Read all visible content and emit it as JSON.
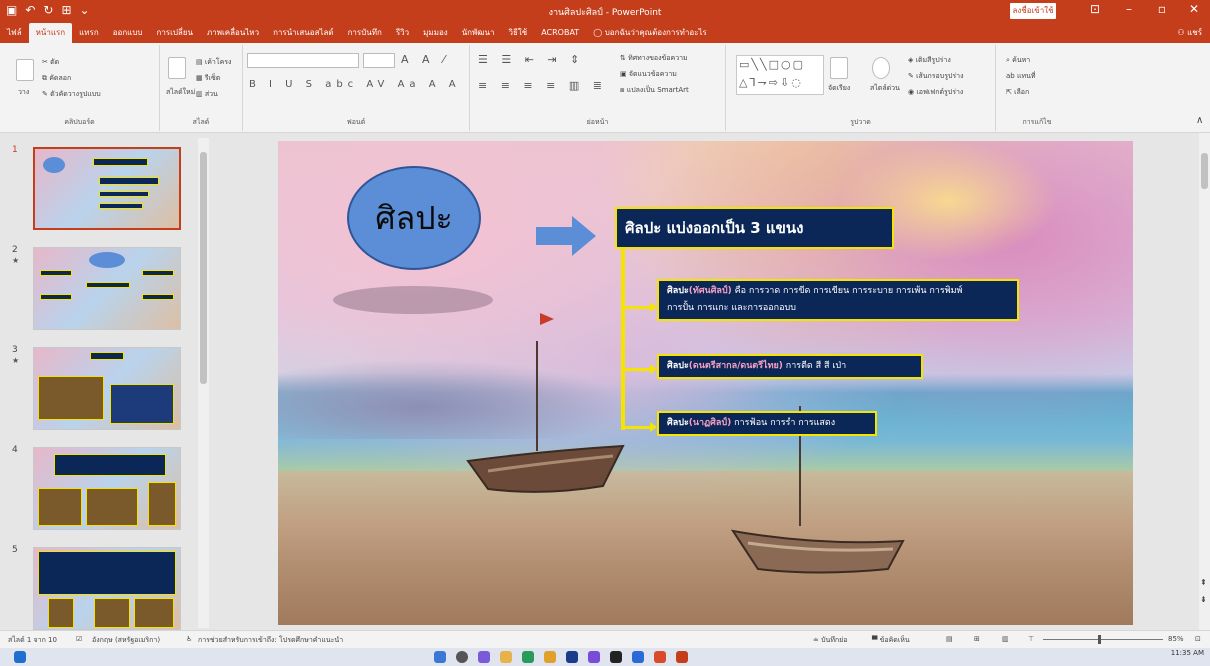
{
  "window": {
    "title": "งานศิลปะศิลป์ - PowerPoint",
    "signin": "ลงชื่อเข้าใช้",
    "share": "แชร์"
  },
  "tabs": [
    "ไฟล์",
    "หน้าแรก",
    "แทรก",
    "ออกแบบ",
    "การเปลี่ยน",
    "ภาพเคลื่อนไหว",
    "การนำเสนอสไลด์",
    "การบันทึก",
    "รีวิว",
    "มุมมอง",
    "นักพัฒนา",
    "วิธีใช้",
    "ACROBAT",
    "บอกฉันว่าคุณต้องการทำอะไร"
  ],
  "ribbon": {
    "clipboard": {
      "paste": "วาง",
      "cut": "ตัด",
      "copy": "คัดลอก",
      "format_painter": "ตัวคัดวางรูปแบบ",
      "name": "คลิปบอร์ด"
    },
    "slides": {
      "new_slide": "สไลด์ใหม่",
      "layout": "เค้าโครง",
      "reset": "รีเซ็ต",
      "section": "ส่วน",
      "name": "สไลด์"
    },
    "font": {
      "name": "ฟอนต์"
    },
    "paragraph": {
      "direction": "ทิศทางของข้อความ",
      "align": "จัดแนวข้อความ",
      "smartart": "แปลงเป็น SmartArt",
      "name": "ย่อหน้า"
    },
    "drawing": {
      "arrange": "จัดเรียง",
      "quick_styles": "สไตล์ด่วน",
      "fill": "เติมสีรูปร่าง",
      "outline": "เส้นกรอบรูปร่าง",
      "effects": "เอฟเฟกต์รูปร่าง",
      "name": "รูปวาด"
    },
    "editing": {
      "find": "ค้นหา",
      "replace": "แทนที่",
      "select": "เลือก",
      "name": "การแก้ไข"
    }
  },
  "thumbnails": [
    {
      "num": "1",
      "star": ""
    },
    {
      "num": "2",
      "star": "★"
    },
    {
      "num": "3",
      "star": "★"
    },
    {
      "num": "4",
      "star": ""
    },
    {
      "num": "5",
      "star": ""
    }
  ],
  "slide": {
    "ellipse_text": "ศิลปะ",
    "header": "ศิลปะ แบ่งออกเป็น 3 แขนง",
    "box1": {
      "pre": "ศิลปะ",
      "hl": "(ทัศนศิลป์)",
      "rest": " คือ การวาด การขีด การเขียน การระบาย การเพ้น การพิมพ์",
      "line2": "การปั้น การแกะ และการออกอบบ"
    },
    "box2": {
      "pre": "ศิลปะ",
      "hl": "(ดนตรีสากล/ดนตรีไทย)",
      "rest": " การตีด สี สี เป่า"
    },
    "box3": {
      "pre": "ศิลปะ",
      "hl": "(นาฏศิลป์)",
      "rest": " การฟ้อน การรำ การแสดง"
    }
  },
  "status": {
    "slide_count": "สไลด์ 1 จาก 10",
    "language": "อังกฤษ (สหรัฐอเมริกา)",
    "accessibility": "การช่วยสำหรับการเข้าถึง: โปรดศึกษาคำแนะนำ",
    "notes": "บันทึกย่อ",
    "comments": "ข้อคิดเห็น",
    "zoom": "85%"
  },
  "clock": "11:35 AM",
  "colors": {
    "accent": "#c43e1c",
    "box": "#0a2757",
    "border": "#f5e400"
  }
}
